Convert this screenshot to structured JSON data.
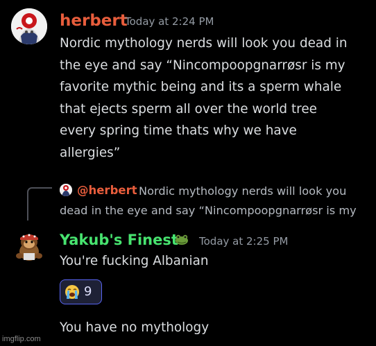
{
  "colors": {
    "background": "#000000",
    "text": "#dbdee1",
    "muted": "#949ba4",
    "herbert_name": "#e85d3c",
    "yakub_name": "#47e36f",
    "reaction_border": "#5865f2",
    "reaction_bg": "#1e2136"
  },
  "message1": {
    "username": "herbert",
    "timestamp": "Today at 2:24 PM",
    "avatar_icon": "avatar-herbert-icon",
    "lines": [
      "Nordic mythology nerds will look you dead in",
      "the eye and say “Nincompoopgnarrøsr is my",
      "favorite mythic being and its a sperm whale",
      "that ejects sperm all over the world tree",
      "every spring time thats why we have",
      "allergies”"
    ]
  },
  "reply": {
    "mention": "@herbert",
    "preview_line1": "Nordic mythology nerds will look you",
    "preview_line2": "dead in the eye and say “Nincompoopgnarrøsr is my"
  },
  "message2": {
    "username": "Yakub's Finest",
    "badge_icon": "frog-icon",
    "timestamp": "Today at 2:25 PM",
    "avatar_icon": "avatar-yakub-icon",
    "text": "You're fucking Albanian",
    "reaction": {
      "emoji": "loudly-crying-face-icon",
      "count": "9"
    }
  },
  "message3": {
    "text": "You have no mythology"
  },
  "watermark": "imgflip.com"
}
